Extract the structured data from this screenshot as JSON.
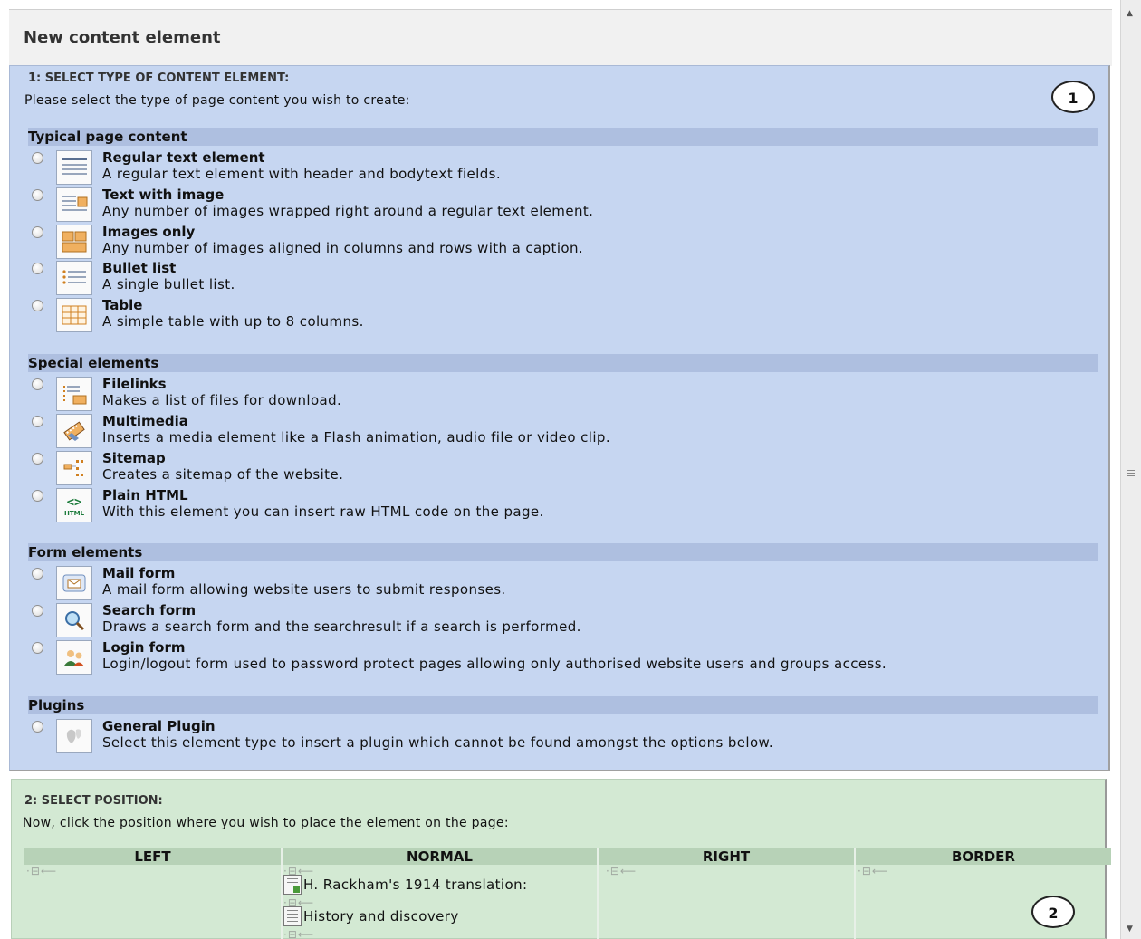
{
  "title": "New content element",
  "section1": {
    "heading": "1: SELECT TYPE OF CONTENT ELEMENT:",
    "intro": "Please select the type of page content you wish to create:",
    "badge": "1",
    "groups": [
      {
        "label": "Typical page content",
        "items": [
          {
            "title": "Regular text element",
            "desc": "A regular text element with header and bodytext fields.",
            "icon": "text-icon"
          },
          {
            "title": "Text with image",
            "desc": "Any number of images wrapped right around a regular text element.",
            "icon": "text-image-icon"
          },
          {
            "title": "Images only",
            "desc": "Any number of images aligned in columns and rows with a caption.",
            "icon": "images-icon"
          },
          {
            "title": "Bullet list",
            "desc": "A single bullet list.",
            "icon": "bullet-list-icon"
          },
          {
            "title": "Table",
            "desc": "A simple table with up to 8 columns.",
            "icon": "table-icon"
          }
        ]
      },
      {
        "label": "Special elements",
        "items": [
          {
            "title": "Filelinks",
            "desc": "Makes a list of files for download.",
            "icon": "filelinks-icon"
          },
          {
            "title": "Multimedia",
            "desc": "Inserts a media element like a Flash animation, audio file or video clip.",
            "icon": "multimedia-icon"
          },
          {
            "title": "Sitemap",
            "desc": "Creates a sitemap of the website.",
            "icon": "sitemap-icon"
          },
          {
            "title": "Plain HTML",
            "desc": "With this element you can insert raw HTML code on the page.",
            "icon": "html-icon"
          }
        ]
      },
      {
        "label": "Form elements",
        "items": [
          {
            "title": "Mail form",
            "desc": "A mail form allowing website users to submit responses.",
            "icon": "mail-icon"
          },
          {
            "title": "Search form",
            "desc": "Draws a search form and the searchresult if a search is performed.",
            "icon": "search-icon"
          },
          {
            "title": "Login form",
            "desc": "Login/logout form used to password protect pages allowing only authorised website users and groups access.",
            "icon": "login-icon"
          }
        ]
      },
      {
        "label": "Plugins",
        "items": [
          {
            "title": "General Plugin",
            "desc": "Select this element type to insert a plugin which cannot be found amongst the options below.",
            "icon": "plugin-icon"
          }
        ]
      }
    ]
  },
  "section2": {
    "heading": "2: SELECT POSITION:",
    "intro": "Now, click the position where you wish to place the element on the page:",
    "badge": "2",
    "columns": [
      "LEFT",
      "NORMAL",
      "RIGHT",
      "BORDER"
    ],
    "normal_items": [
      "H. Rackham's 1914 translation:",
      "History and discovery"
    ]
  }
}
